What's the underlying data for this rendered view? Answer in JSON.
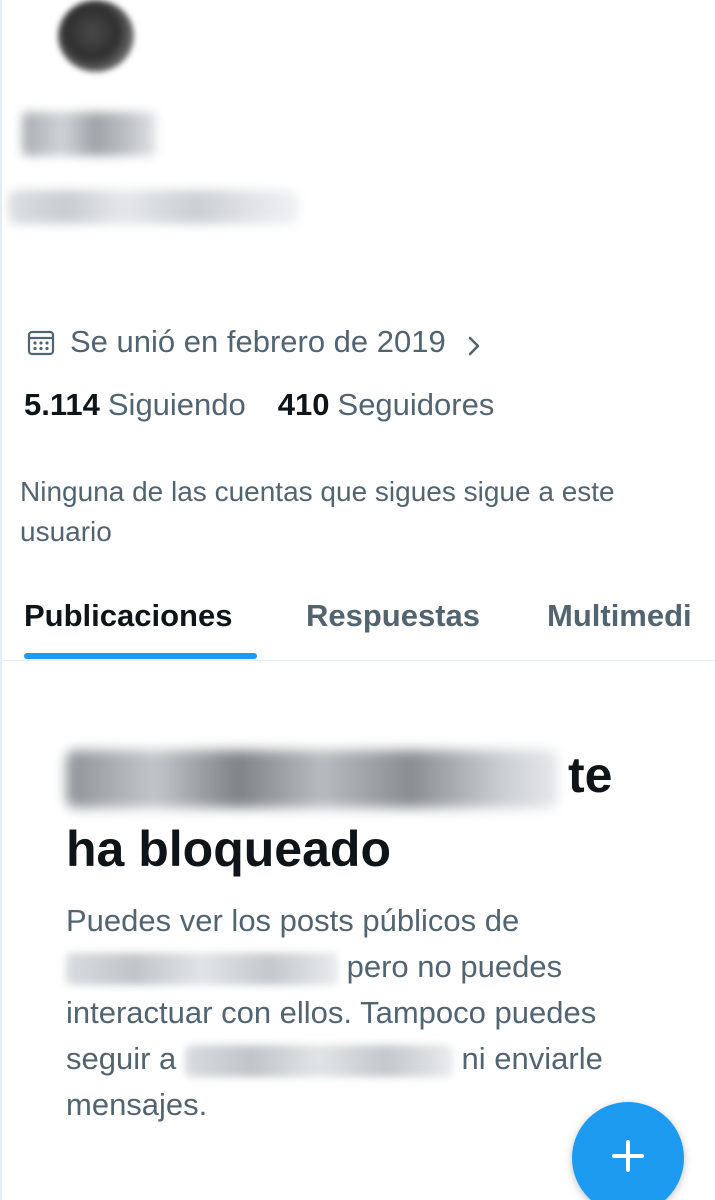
{
  "profile": {
    "joined_text": "Se unió en febrero de 2019",
    "following_count": "5.114",
    "following_label": "Siguiendo",
    "followers_count": "410",
    "followers_label": "Seguidores",
    "mutual_text": "Ninguna de las cuentas que sigues sigue a este usuario"
  },
  "tabs": [
    {
      "label": "Publicaciones",
      "active": true
    },
    {
      "label": "Respuestas",
      "active": false
    },
    {
      "label": "Multimedi",
      "active": false
    }
  ],
  "blocked": {
    "title_suffix": "te",
    "title_line2": "ha bloqueado",
    "body_part1": "Puedes ver los posts públicos de",
    "body_part2": "pero no puedes interactuar con ellos. Tampoco puedes seguir a",
    "body_part3": "ni enviarle mensajes."
  },
  "colors": {
    "accent": "#1d9bf0",
    "text_primary": "#0f1419",
    "text_secondary": "#536471"
  },
  "icons": {
    "joined": "calendar-icon",
    "joined_arrow": "chevron-right-icon",
    "fab": "plus-icon"
  }
}
